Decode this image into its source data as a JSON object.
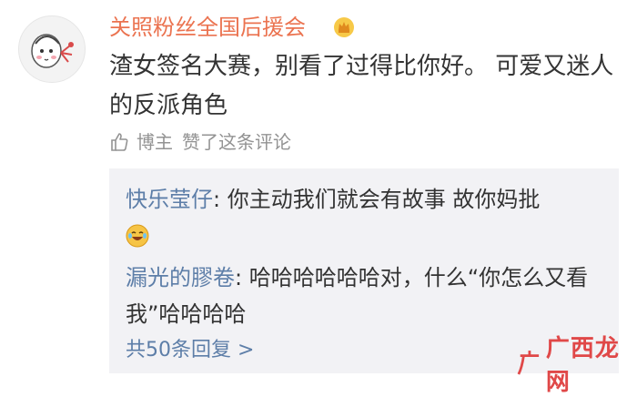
{
  "comment": {
    "username": "关照粉丝全国后援会",
    "text": "渣女签名大赛，别看了过得比你好。 可爱又迷人的反派角色",
    "liked_by": "博主",
    "liked_text": "赞了这条评论",
    "user_badge_icon": "crown-icon",
    "colors": {
      "username": "#eb7350",
      "link": "#5d7ea8"
    }
  },
  "replies": [
    {
      "author": "快乐莹仔",
      "text": ": 你主动我们就会有故事 故你妈批",
      "emoji": "laughing-tears-emoji"
    },
    {
      "author": "漏光的膠卷",
      "text": ": 哈哈哈哈哈哈对，什么“你怎么又看我”哈哈哈哈"
    }
  ],
  "more_replies": "共50条回复 >",
  "watermark": {
    "text": "广西龙网",
    "mark": "广"
  }
}
